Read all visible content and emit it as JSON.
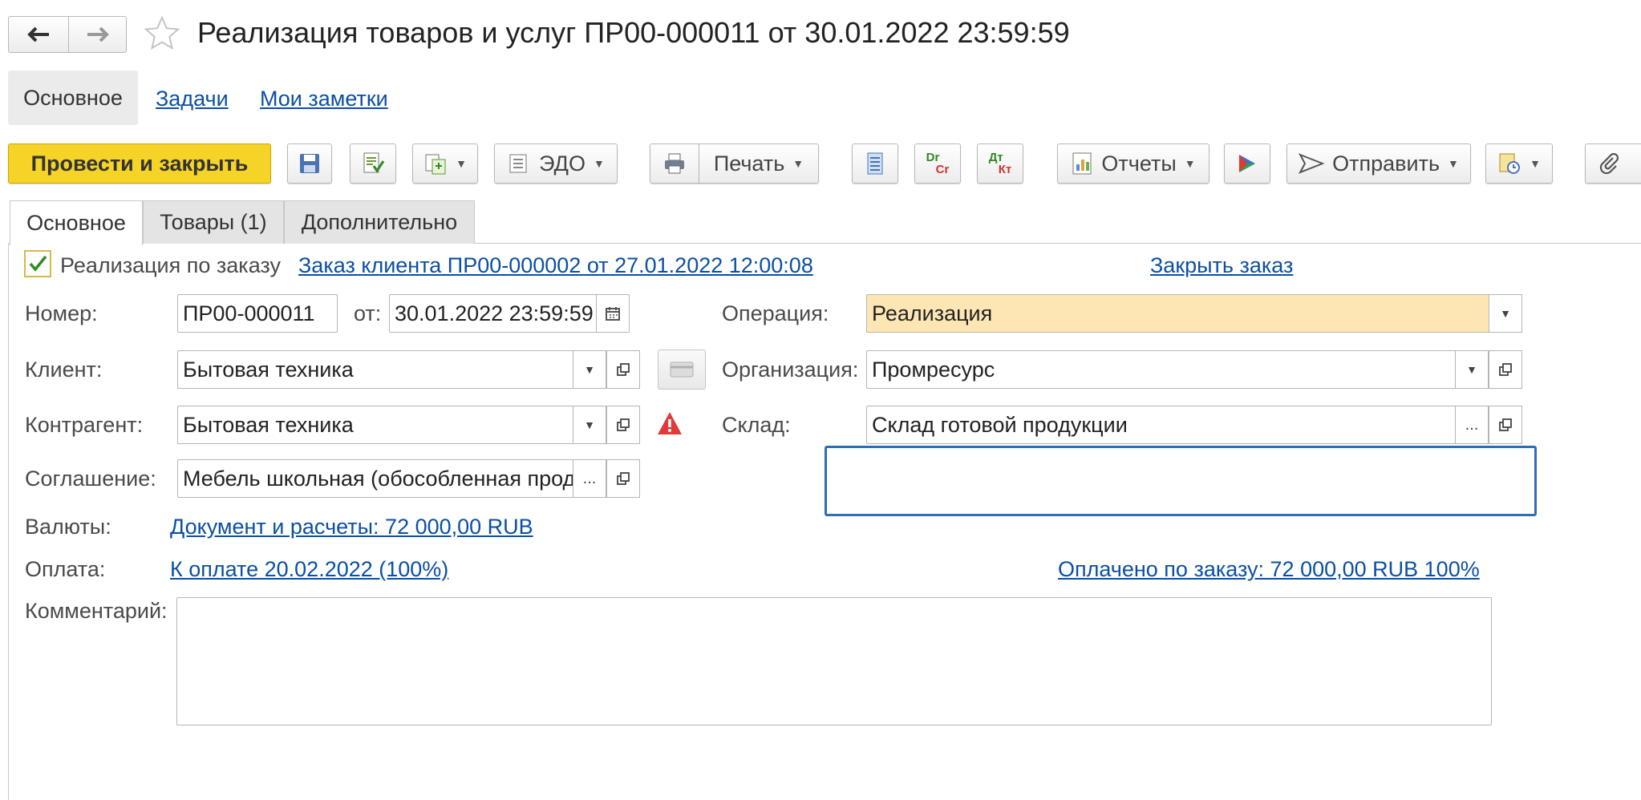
{
  "nav": {
    "back_icon": "arrow-left-icon",
    "forward_icon": "arrow-right-icon",
    "favorite_icon": "star-icon"
  },
  "title": "Реализация товаров и услуг ПР00-000011 от 30.01.2022 23:59:59",
  "top_tabs": {
    "main": "Основное",
    "tasks": "Задачи",
    "notes": "Мои заметки"
  },
  "toolbar": {
    "post_close": "Провести и закрыть",
    "edo": "ЭДО",
    "print": "Печать",
    "dr": "Dr",
    "cr": "Cr",
    "dt": "Дт",
    "kt": "Кт",
    "reports": "Отчеты",
    "send": "Отправить",
    "post_close_color": "#f5d327"
  },
  "form_tabs": {
    "main": "Основное",
    "goods": "Товары (1)",
    "extra": "Дополнительно"
  },
  "order": {
    "checkbox_label": "Реализация по заказу",
    "checked": true,
    "order_link": "Заказ клиента ПР00-000002 от 27.01.2022 12:00:08",
    "close_order": "Закрыть заказ"
  },
  "fields": {
    "number_label": "Номер:",
    "number": "ПР00-000011",
    "from_label": "от:",
    "date": "30.01.2022 23:59:59",
    "operation_label": "Операция:",
    "operation": "Реализация",
    "client_label": "Клиент:",
    "client": "Бытовая техника",
    "organization_label": "Организация:",
    "organization": "Промресурс",
    "counterparty_label": "Контрагент:",
    "counterparty": "Бытовая техника",
    "warehouse_label": "Склад:",
    "warehouse": "Склад готовой продукции",
    "agreement_label": "Соглашение:",
    "agreement": "Мебель школьная (обособленная продажа)",
    "currency_label": "Валюты:",
    "currency_link": "Документ и расчеты: 72 000,00 RUB",
    "payment_label": "Оплата:",
    "payment_link": "К оплате 20.02.2022 (100%)",
    "paid_link": "Оплачено по заказу: 72 000,00 RUB 100%",
    "comment_label": "Комментарий:",
    "comment": ""
  },
  "ellipsis": "...",
  "colors": {
    "link": "#0b4fa4",
    "operation_bg": "#fde6b3",
    "focus_border": "#2f6db5",
    "warning": "#e03a3a"
  }
}
